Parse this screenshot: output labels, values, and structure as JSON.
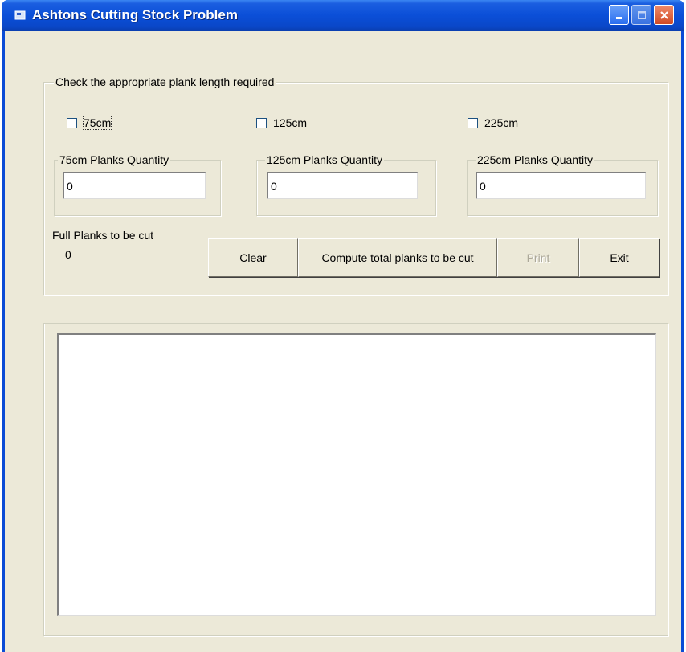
{
  "window": {
    "title": "Ashtons Cutting Stock Problem",
    "icon": "app-icon",
    "controls": [
      "minimize-icon",
      "maximize-icon",
      "close-icon"
    ],
    "colors": {
      "titlebar": "#0b4fd8",
      "client": "#ece9d8",
      "close": "#d04a24"
    }
  },
  "plank_selection": {
    "caption": "Check the appropriate  plank length required",
    "options": [
      {
        "label": "75cm",
        "checked": false
      },
      {
        "label": "125cm",
        "checked": false
      },
      {
        "label": "225cm",
        "checked": false
      }
    ]
  },
  "quantities": [
    {
      "caption": "75cm Planks Quantity",
      "value": "0"
    },
    {
      "caption": "125cm Planks Quantity",
      "value": "0"
    },
    {
      "caption": "225cm Planks Quantity",
      "value": "0"
    }
  ],
  "result": {
    "label": "Full Planks to be cut",
    "value": "0"
  },
  "buttons": {
    "clear": "Clear",
    "compute": "Compute total planks to be cut",
    "print": "Print",
    "exit": "Exit"
  },
  "output": {
    "text": ""
  }
}
